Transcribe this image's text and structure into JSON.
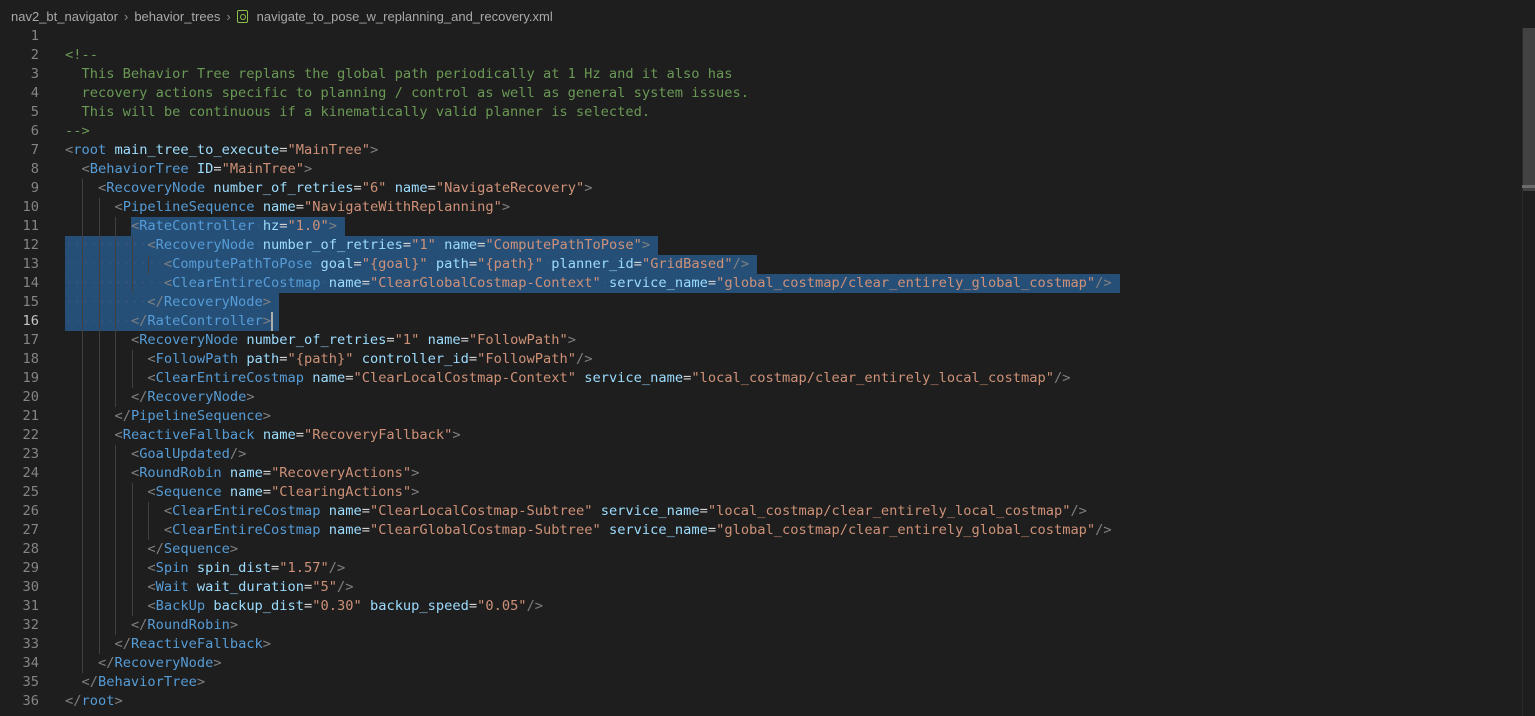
{
  "breadcrumb": {
    "items": [
      "nav2_bt_navigator",
      "behavior_trees",
      "navigate_to_pose_w_replanning_and_recovery.xml"
    ],
    "file_icon": "xml-file-icon"
  },
  "editor": {
    "active_line": 16,
    "lines": [
      {
        "n": "1",
        "t": []
      },
      {
        "n": "2",
        "t": [
          [
            "comment",
            "<!--"
          ]
        ]
      },
      {
        "n": "3",
        "t": [
          [
            "comment",
            "  This Behavior Tree replans the global path periodically at 1 Hz and it also has"
          ]
        ]
      },
      {
        "n": "4",
        "t": [
          [
            "comment",
            "  recovery actions specific to planning / control as well as general system issues."
          ]
        ]
      },
      {
        "n": "5",
        "t": [
          [
            "comment",
            "  This will be continuous if a kinematically valid planner is selected."
          ]
        ]
      },
      {
        "n": "6",
        "t": [
          [
            "comment",
            "-->"
          ]
        ]
      },
      {
        "n": "7",
        "t": [
          [
            "punct",
            "<"
          ],
          [
            "tag",
            "root"
          ],
          [
            "plain",
            " "
          ],
          [
            "attr",
            "main_tree_to_execute"
          ],
          [
            "plain",
            "="
          ],
          [
            "str",
            "\"MainTree\""
          ],
          [
            "punct",
            ">"
          ]
        ]
      },
      {
        "n": "8",
        "t": [
          [
            "plain",
            "  "
          ],
          [
            "punct",
            "<"
          ],
          [
            "tag",
            "BehaviorTree"
          ],
          [
            "plain",
            " "
          ],
          [
            "attr",
            "ID"
          ],
          [
            "plain",
            "="
          ],
          [
            "str",
            "\"MainTree\""
          ],
          [
            "punct",
            ">"
          ]
        ]
      },
      {
        "n": "9",
        "t": [
          [
            "plain",
            "    "
          ],
          [
            "punct",
            "<"
          ],
          [
            "tag",
            "RecoveryNode"
          ],
          [
            "plain",
            " "
          ],
          [
            "attr",
            "number_of_retries"
          ],
          [
            "plain",
            "="
          ],
          [
            "str",
            "\"6\""
          ],
          [
            "plain",
            " "
          ],
          [
            "attr",
            "name"
          ],
          [
            "plain",
            "="
          ],
          [
            "str",
            "\"NavigateRecovery\""
          ],
          [
            "punct",
            ">"
          ]
        ]
      },
      {
        "n": "10",
        "t": [
          [
            "plain",
            "      "
          ],
          [
            "punct",
            "<"
          ],
          [
            "tag",
            "PipelineSequence"
          ],
          [
            "plain",
            " "
          ],
          [
            "attr",
            "name"
          ],
          [
            "plain",
            "="
          ],
          [
            "str",
            "\"NavigateWithReplanning\""
          ],
          [
            "punct",
            ">"
          ]
        ]
      },
      {
        "n": "11",
        "t": [
          [
            "plain",
            "        "
          ],
          [
            "punct",
            "<"
          ],
          [
            "tag",
            "RateController"
          ],
          [
            "ws",
            "·"
          ],
          [
            "attr",
            "hz"
          ],
          [
            "plain",
            "="
          ],
          [
            "str",
            "\"1.0\""
          ],
          [
            "punct",
            ">"
          ]
        ]
      },
      {
        "n": "12",
        "t": [
          [
            "ws",
            "··········"
          ],
          [
            "punct",
            "<"
          ],
          [
            "tag",
            "RecoveryNode"
          ],
          [
            "ws",
            "·"
          ],
          [
            "attr",
            "number_of_retries"
          ],
          [
            "plain",
            "="
          ],
          [
            "str",
            "\"1\""
          ],
          [
            "ws",
            "·"
          ],
          [
            "attr",
            "name"
          ],
          [
            "plain",
            "="
          ],
          [
            "str",
            "\"ComputePathToPose\""
          ],
          [
            "punct",
            ">"
          ]
        ]
      },
      {
        "n": "13",
        "t": [
          [
            "ws",
            "············"
          ],
          [
            "punct",
            "<"
          ],
          [
            "tag",
            "ComputePathToPose"
          ],
          [
            "ws",
            "·"
          ],
          [
            "attr",
            "goal"
          ],
          [
            "plain",
            "="
          ],
          [
            "str",
            "\"{goal}\""
          ],
          [
            "ws",
            "·"
          ],
          [
            "attr",
            "path"
          ],
          [
            "plain",
            "="
          ],
          [
            "str",
            "\"{path}\""
          ],
          [
            "ws",
            "·"
          ],
          [
            "attr",
            "planner_id"
          ],
          [
            "plain",
            "="
          ],
          [
            "str",
            "\"GridBased\""
          ],
          [
            "punct",
            "/>"
          ]
        ]
      },
      {
        "n": "14",
        "t": [
          [
            "ws",
            "············"
          ],
          [
            "punct",
            "<"
          ],
          [
            "tag",
            "ClearEntireCostmap"
          ],
          [
            "ws",
            "·"
          ],
          [
            "attr",
            "name"
          ],
          [
            "plain",
            "="
          ],
          [
            "str",
            "\"ClearGlobalCostmap-Context\""
          ],
          [
            "ws",
            "·"
          ],
          [
            "attr",
            "service_name"
          ],
          [
            "plain",
            "="
          ],
          [
            "str",
            "\"global_costmap/clear_entirely_global_costmap\""
          ],
          [
            "punct",
            "/>"
          ]
        ]
      },
      {
        "n": "15",
        "t": [
          [
            "ws",
            "··········"
          ],
          [
            "punct",
            "</"
          ],
          [
            "tag",
            "RecoveryNode"
          ],
          [
            "punct",
            ">"
          ]
        ]
      },
      {
        "n": "16",
        "t": [
          [
            "ws",
            "········"
          ],
          [
            "punct",
            "</"
          ],
          [
            "tag",
            "RateController"
          ],
          [
            "punct",
            ">"
          ]
        ]
      },
      {
        "n": "17",
        "t": [
          [
            "plain",
            "        "
          ],
          [
            "punct",
            "<"
          ],
          [
            "tag",
            "RecoveryNode"
          ],
          [
            "plain",
            " "
          ],
          [
            "attr",
            "number_of_retries"
          ],
          [
            "plain",
            "="
          ],
          [
            "str",
            "\"1\""
          ],
          [
            "plain",
            " "
          ],
          [
            "attr",
            "name"
          ],
          [
            "plain",
            "="
          ],
          [
            "str",
            "\"FollowPath\""
          ],
          [
            "punct",
            ">"
          ]
        ]
      },
      {
        "n": "18",
        "t": [
          [
            "plain",
            "          "
          ],
          [
            "punct",
            "<"
          ],
          [
            "tag",
            "FollowPath"
          ],
          [
            "plain",
            " "
          ],
          [
            "attr",
            "path"
          ],
          [
            "plain",
            "="
          ],
          [
            "str",
            "\"{path}\""
          ],
          [
            "plain",
            " "
          ],
          [
            "attr",
            "controller_id"
          ],
          [
            "plain",
            "="
          ],
          [
            "str",
            "\"FollowPath\""
          ],
          [
            "punct",
            "/>"
          ]
        ]
      },
      {
        "n": "19",
        "t": [
          [
            "plain",
            "          "
          ],
          [
            "punct",
            "<"
          ],
          [
            "tag",
            "ClearEntireCostmap"
          ],
          [
            "plain",
            " "
          ],
          [
            "attr",
            "name"
          ],
          [
            "plain",
            "="
          ],
          [
            "str",
            "\"ClearLocalCostmap-Context\""
          ],
          [
            "plain",
            " "
          ],
          [
            "attr",
            "service_name"
          ],
          [
            "plain",
            "="
          ],
          [
            "str",
            "\"local_costmap/clear_entirely_local_costmap\""
          ],
          [
            "punct",
            "/>"
          ]
        ]
      },
      {
        "n": "20",
        "t": [
          [
            "plain",
            "        "
          ],
          [
            "punct",
            "</"
          ],
          [
            "tag",
            "RecoveryNode"
          ],
          [
            "punct",
            ">"
          ]
        ]
      },
      {
        "n": "21",
        "t": [
          [
            "plain",
            "      "
          ],
          [
            "punct",
            "</"
          ],
          [
            "tag",
            "PipelineSequence"
          ],
          [
            "punct",
            ">"
          ]
        ]
      },
      {
        "n": "22",
        "t": [
          [
            "plain",
            "      "
          ],
          [
            "punct",
            "<"
          ],
          [
            "tag",
            "ReactiveFallback"
          ],
          [
            "plain",
            " "
          ],
          [
            "attr",
            "name"
          ],
          [
            "plain",
            "="
          ],
          [
            "str",
            "\"RecoveryFallback\""
          ],
          [
            "punct",
            ">"
          ]
        ]
      },
      {
        "n": "23",
        "t": [
          [
            "plain",
            "        "
          ],
          [
            "punct",
            "<"
          ],
          [
            "tag",
            "GoalUpdated"
          ],
          [
            "punct",
            "/>"
          ]
        ]
      },
      {
        "n": "24",
        "t": [
          [
            "plain",
            "        "
          ],
          [
            "punct",
            "<"
          ],
          [
            "tag",
            "RoundRobin"
          ],
          [
            "plain",
            " "
          ],
          [
            "attr",
            "name"
          ],
          [
            "plain",
            "="
          ],
          [
            "str",
            "\"RecoveryActions\""
          ],
          [
            "punct",
            ">"
          ]
        ]
      },
      {
        "n": "25",
        "t": [
          [
            "plain",
            "          "
          ],
          [
            "punct",
            "<"
          ],
          [
            "tag",
            "Sequence"
          ],
          [
            "plain",
            " "
          ],
          [
            "attr",
            "name"
          ],
          [
            "plain",
            "="
          ],
          [
            "str",
            "\"ClearingActions\""
          ],
          [
            "punct",
            ">"
          ]
        ]
      },
      {
        "n": "26",
        "t": [
          [
            "plain",
            "            "
          ],
          [
            "punct",
            "<"
          ],
          [
            "tag",
            "ClearEntireCostmap"
          ],
          [
            "plain",
            " "
          ],
          [
            "attr",
            "name"
          ],
          [
            "plain",
            "="
          ],
          [
            "str",
            "\"ClearLocalCostmap-Subtree\""
          ],
          [
            "plain",
            " "
          ],
          [
            "attr",
            "service_name"
          ],
          [
            "plain",
            "="
          ],
          [
            "str",
            "\"local_costmap/clear_entirely_local_costmap\""
          ],
          [
            "punct",
            "/>"
          ]
        ]
      },
      {
        "n": "27",
        "t": [
          [
            "plain",
            "            "
          ],
          [
            "punct",
            "<"
          ],
          [
            "tag",
            "ClearEntireCostmap"
          ],
          [
            "plain",
            " "
          ],
          [
            "attr",
            "name"
          ],
          [
            "plain",
            "="
          ],
          [
            "str",
            "\"ClearGlobalCostmap-Subtree\""
          ],
          [
            "plain",
            " "
          ],
          [
            "attr",
            "service_name"
          ],
          [
            "plain",
            "="
          ],
          [
            "str",
            "\"global_costmap/clear_entirely_global_costmap\""
          ],
          [
            "punct",
            "/>"
          ]
        ]
      },
      {
        "n": "28",
        "t": [
          [
            "plain",
            "          "
          ],
          [
            "punct",
            "</"
          ],
          [
            "tag",
            "Sequence"
          ],
          [
            "punct",
            ">"
          ]
        ]
      },
      {
        "n": "29",
        "t": [
          [
            "plain",
            "          "
          ],
          [
            "punct",
            "<"
          ],
          [
            "tag",
            "Spin"
          ],
          [
            "plain",
            " "
          ],
          [
            "attr",
            "spin_dist"
          ],
          [
            "plain",
            "="
          ],
          [
            "str",
            "\"1.57\""
          ],
          [
            "punct",
            "/>"
          ]
        ]
      },
      {
        "n": "30",
        "t": [
          [
            "plain",
            "          "
          ],
          [
            "punct",
            "<"
          ],
          [
            "tag",
            "Wait"
          ],
          [
            "plain",
            " "
          ],
          [
            "attr",
            "wait_duration"
          ],
          [
            "plain",
            "="
          ],
          [
            "str",
            "\"5\""
          ],
          [
            "punct",
            "/>"
          ]
        ]
      },
      {
        "n": "31",
        "t": [
          [
            "plain",
            "          "
          ],
          [
            "punct",
            "<"
          ],
          [
            "tag",
            "BackUp"
          ],
          [
            "plain",
            " "
          ],
          [
            "attr",
            "backup_dist"
          ],
          [
            "plain",
            "="
          ],
          [
            "str",
            "\"0.30\""
          ],
          [
            "plain",
            " "
          ],
          [
            "attr",
            "backup_speed"
          ],
          [
            "plain",
            "="
          ],
          [
            "str",
            "\"0.05\""
          ],
          [
            "punct",
            "/>"
          ]
        ]
      },
      {
        "n": "32",
        "t": [
          [
            "plain",
            "        "
          ],
          [
            "punct",
            "</"
          ],
          [
            "tag",
            "RoundRobin"
          ],
          [
            "punct",
            ">"
          ]
        ]
      },
      {
        "n": "33",
        "t": [
          [
            "plain",
            "      "
          ],
          [
            "punct",
            "</"
          ],
          [
            "tag",
            "ReactiveFallback"
          ],
          [
            "punct",
            ">"
          ]
        ]
      },
      {
        "n": "34",
        "t": [
          [
            "plain",
            "    "
          ],
          [
            "punct",
            "</"
          ],
          [
            "tag",
            "RecoveryNode"
          ],
          [
            "punct",
            ">"
          ]
        ]
      },
      {
        "n": "35",
        "t": [
          [
            "plain",
            "  "
          ],
          [
            "punct",
            "</"
          ],
          [
            "tag",
            "BehaviorTree"
          ],
          [
            "punct",
            ">"
          ]
        ]
      },
      {
        "n": "36",
        "t": [
          [
            "punct",
            "</"
          ],
          [
            "tag",
            "root"
          ],
          [
            "punct",
            ">"
          ]
        ]
      }
    ]
  },
  "colors": {
    "background": "#1e1e1e",
    "selection": "#264f78",
    "comment": "#6a9955",
    "tag": "#569cd6",
    "attribute": "#9cdcfe",
    "string": "#ce9178"
  }
}
